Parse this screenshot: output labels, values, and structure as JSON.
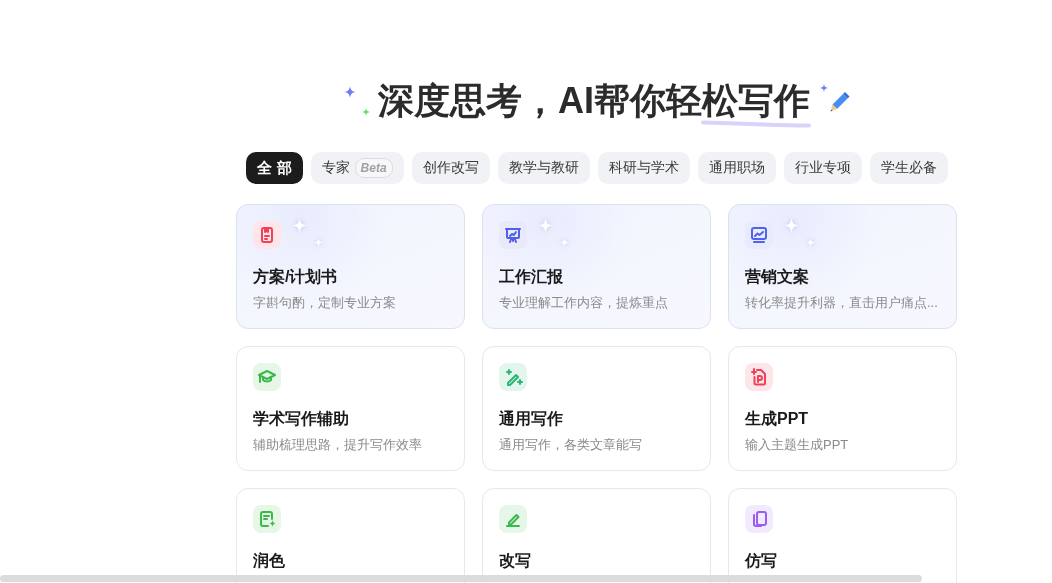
{
  "heading": {
    "title": "深度思考，AI帮你轻松写作"
  },
  "tabs": [
    {
      "label": "全 部",
      "selected": true
    },
    {
      "label": "专家",
      "badge": "Beta",
      "selected": false
    },
    {
      "label": "创作改写",
      "selected": false
    },
    {
      "label": "教学与教研",
      "selected": false
    },
    {
      "label": "科研与学术",
      "selected": false
    },
    {
      "label": "通用职场",
      "selected": false
    },
    {
      "label": "行业专项",
      "selected": false
    },
    {
      "label": "学生必备",
      "selected": false
    }
  ],
  "cards": [
    {
      "title": "方案/计划书",
      "description": "字斟句酌，定制专业方案",
      "featured": true,
      "color": "#f0405a"
    },
    {
      "title": "工作汇报",
      "description": "专业理解工作内容，提炼重点",
      "featured": true,
      "color": "#4f5fe8"
    },
    {
      "title": "营销文案",
      "description": "转化率提升利器，直击用户痛点...",
      "featured": true,
      "color": "#4f62ee"
    },
    {
      "title": "学术写作辅助",
      "description": "辅助梳理思路，提升写作效率",
      "featured": false,
      "color": "#3cb94a"
    },
    {
      "title": "通用写作",
      "description": "通用写作，各类文章能写",
      "featured": false,
      "color": "#2bb673"
    },
    {
      "title": "生成PPT",
      "description": "输入主题生成PPT",
      "featured": false,
      "color": "#f0405a"
    },
    {
      "title": "润色",
      "featured": false,
      "color": "#3cb94a"
    },
    {
      "title": "改写",
      "featured": false,
      "color": "#3db84c"
    },
    {
      "title": "仿写",
      "featured": false,
      "color": "#9b5cf0"
    }
  ]
}
